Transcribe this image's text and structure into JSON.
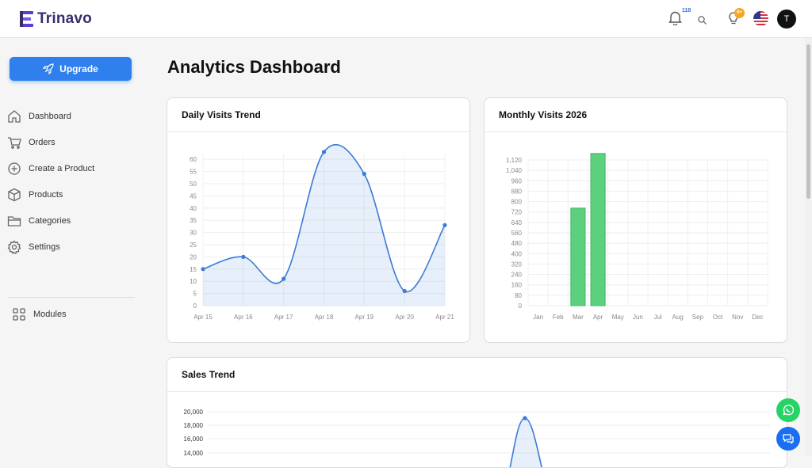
{
  "app": {
    "name": "Trinavo"
  },
  "topbar": {
    "notifications_count": "118",
    "tips_count": "9+",
    "avatar_initial": "T"
  },
  "sidebar": {
    "upgrade_label": "Upgrade",
    "items": [
      {
        "label": "Dashboard",
        "icon": "home-icon"
      },
      {
        "label": "Orders",
        "icon": "cart-icon"
      },
      {
        "label": "Create a Product",
        "icon": "plus-circle-icon"
      },
      {
        "label": "Products",
        "icon": "box-icon"
      },
      {
        "label": "Categories",
        "icon": "folder-icon"
      },
      {
        "label": "Settings",
        "icon": "gear-icon"
      }
    ],
    "modules_label": "Modules"
  },
  "main": {
    "title": "Analytics Dashboard"
  },
  "colors": {
    "accent": "#2f80ed",
    "line": "#3a7bd5",
    "bar": "#5dd07f"
  },
  "chart_data": [
    {
      "type": "area",
      "title": "Daily Visits Trend",
      "categories": [
        "Apr 15",
        "Apr 16",
        "Apr 17",
        "Apr 18",
        "Apr 19",
        "Apr 20",
        "Apr 21"
      ],
      "values": [
        15,
        20,
        11,
        63,
        54,
        6,
        33
      ],
      "yticks": [
        0,
        5,
        10,
        15,
        20,
        25,
        30,
        35,
        40,
        45,
        50,
        55,
        60
      ],
      "ylim": [
        0,
        62
      ],
      "grid": true
    },
    {
      "type": "bar",
      "title": "Monthly Visits 2026",
      "categories": [
        "Jan",
        "Feb",
        "Mar",
        "Apr",
        "May",
        "Jun",
        "Jul",
        "Aug",
        "Sep",
        "Oct",
        "Nov",
        "Dec"
      ],
      "values": [
        0,
        0,
        750,
        1170,
        0,
        0,
        0,
        0,
        0,
        0,
        0,
        0
      ],
      "yticks": [
        "0",
        "80",
        "160",
        "240",
        "320",
        "400",
        "480",
        "560",
        "640",
        "720",
        "800",
        "880",
        "960",
        "1,040",
        "1,120"
      ],
      "ylim": [
        0,
        1120
      ],
      "grid": true
    },
    {
      "type": "area",
      "title": "Sales Trend",
      "yticks": [
        "20,000",
        "18,000",
        "16,000",
        "14,000"
      ],
      "grid": true
    }
  ]
}
